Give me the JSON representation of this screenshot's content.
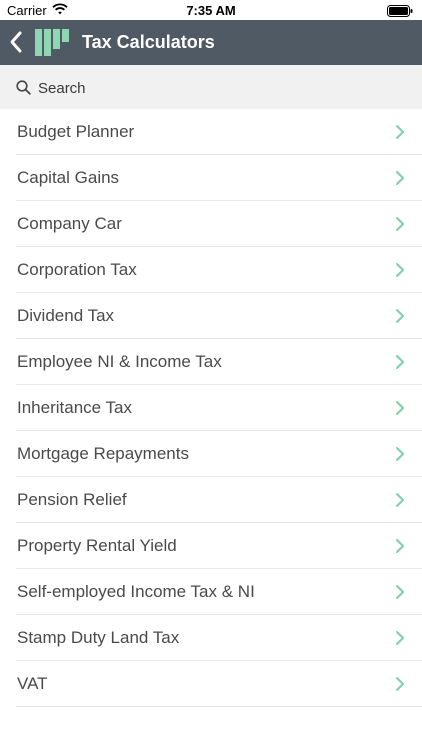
{
  "status_bar": {
    "carrier": "Carrier",
    "time": "7:35 AM",
    "wifi_icon": "wifi-icon",
    "battery_icon": "battery-icon"
  },
  "nav": {
    "title": "Tax Calculators",
    "back_icon": "chevron-left-icon",
    "logo_icon": "app-logo-bars",
    "bar_color": "#505a65",
    "logo_color": "#8fd6b2"
  },
  "search": {
    "placeholder": "Search",
    "icon": "search-icon"
  },
  "accent": "#7fcfa8",
  "calculators": [
    {
      "label": "Budget Planner"
    },
    {
      "label": "Capital Gains"
    },
    {
      "label": "Company Car"
    },
    {
      "label": "Corporation Tax"
    },
    {
      "label": "Dividend Tax"
    },
    {
      "label": "Employee NI & Income Tax"
    },
    {
      "label": "Inheritance Tax"
    },
    {
      "label": "Mortgage Repayments"
    },
    {
      "label": "Pension Relief"
    },
    {
      "label": "Property Rental Yield"
    },
    {
      "label": "Self-employed Income Tax & NI"
    },
    {
      "label": "Stamp Duty Land Tax"
    },
    {
      "label": "VAT"
    }
  ]
}
